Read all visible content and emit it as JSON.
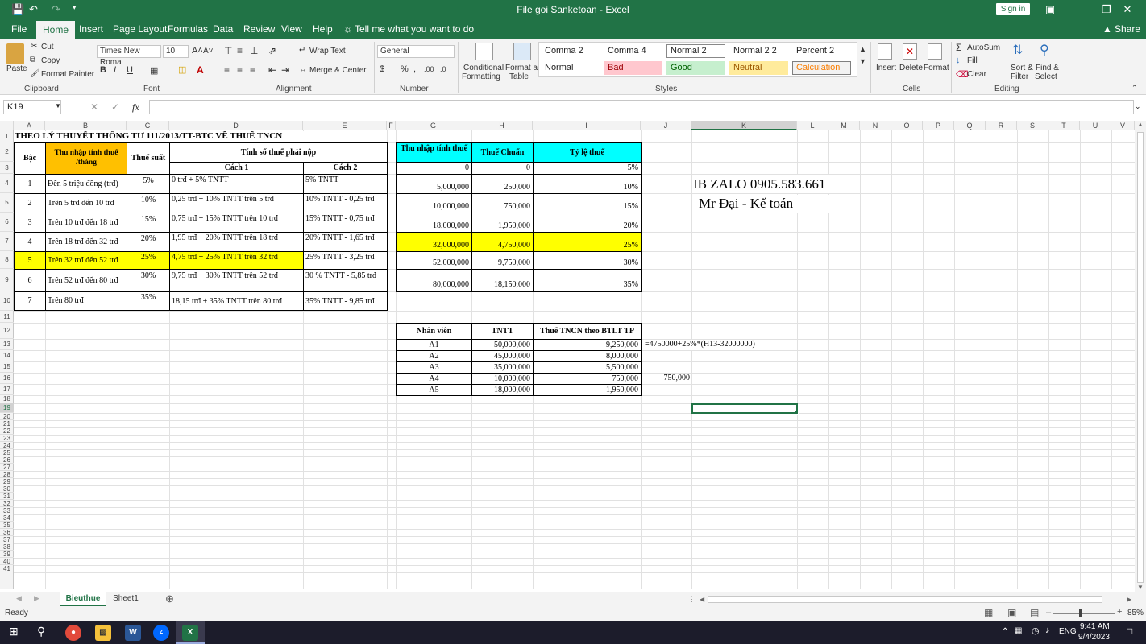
{
  "window": {
    "title": "File goi Sanketoan  -  Excel",
    "sign_in": "Sign in"
  },
  "ribbon_tabs": [
    "File",
    "Home",
    "Insert",
    "Page Layout",
    "Formulas",
    "Data",
    "Review",
    "View",
    "Help"
  ],
  "tell_me": "Tell me what you want to do",
  "share": "Share",
  "clipboard": {
    "paste": "Paste",
    "cut": "Cut",
    "copy": "Copy",
    "format_painter": "Format Painter",
    "group": "Clipboard"
  },
  "font": {
    "name": "Times New Roma",
    "size": "10",
    "group": "Font"
  },
  "alignment": {
    "wrap": "Wrap Text",
    "merge": "Merge & Center",
    "group": "Alignment"
  },
  "number": {
    "format": "General",
    "group": "Number"
  },
  "styles": {
    "conditional": "Conditional",
    "formatting": "Formatting",
    "format_as": "Format as",
    "table": "Table",
    "group": "Styles",
    "cells": [
      "Comma 2",
      "Comma 4",
      "Normal 2",
      "Normal 2 2",
      "Percent 2",
      "Normal",
      "Bad",
      "Good",
      "Neutral",
      "Calculation"
    ]
  },
  "cells_group": {
    "insert": "Insert",
    "delete": "Delete",
    "format": "Format",
    "group": "Cells"
  },
  "editing": {
    "autosum": "AutoSum",
    "fill": "Fill",
    "clear": "Clear",
    "sort": "Sort &",
    "filter": "Filter",
    "find": "Find &",
    "select": "Select",
    "group": "Editing"
  },
  "formula_bar": {
    "name_box": "K19",
    "fx": "fx",
    "formula": ""
  },
  "columns": [
    "A",
    "B",
    "C",
    "D",
    "E",
    "F",
    "G",
    "H",
    "I",
    "J",
    "K",
    "L",
    "M",
    "N",
    "O",
    "P",
    "Q",
    "R",
    "S",
    "T",
    "U",
    "V"
  ],
  "rows": [
    "1",
    "2",
    "3",
    "4",
    "5",
    "6",
    "7",
    "8",
    "9",
    "10",
    "11",
    "12",
    "13",
    "14",
    "15",
    "16",
    "17",
    "18",
    "19",
    "20",
    "21",
    "22",
    "23",
    "24",
    "25",
    "26",
    "27",
    "28",
    "29",
    "30",
    "31",
    "32",
    "33",
    "34",
    "35",
    "36",
    "37",
    "38",
    "39",
    "40",
    "41"
  ],
  "sheet": {
    "title": "THEO LÝ THUYẾT THÔNG TƯ 111/2013/TT-BTC VỀ THUẾ TNCN",
    "h_bac": "Bậc",
    "h_thunhap": "Thu nhập tính thuế /tháng",
    "h_thuesuat": "Thuế suất",
    "h_tinhso": "Tính số thuế phải nộp",
    "h_cach1": "Cách 1",
    "h_cach2": "Cách 2",
    "rows": [
      {
        "bac": "1",
        "thunhap": "Đến 5 triệu đồng (trđ)",
        "suat": "5%",
        "c1": "0 trđ + 5% TNTT",
        "c2": "5% TNTT"
      },
      {
        "bac": "2",
        "thunhap": "Trên 5 trđ đến 10 trđ",
        "suat": "10%",
        "c1": "0,25 trđ + 10% TNTT trên 5 trđ",
        "c2": "10% TNTT - 0,25 trđ"
      },
      {
        "bac": "3",
        "thunhap": "Trên 10 trđ đến 18 trđ",
        "suat": "15%",
        "c1": "0,75 trđ + 15% TNTT trên 10 trđ",
        "c2": "15% TNTT - 0,75 trđ"
      },
      {
        "bac": "4",
        "thunhap": "Trên 18 trđ đến 32 trđ",
        "suat": "20%",
        "c1": "1,95 trđ + 20% TNTT trên 18 trđ",
        "c2": "20% TNTT - 1,65 trđ"
      },
      {
        "bac": "5",
        "thunhap": "Trên 32 trđ đến 52 trđ",
        "suat": "25%",
        "c1": "4,75 trđ + 25% TNTT trên 32 trđ",
        "c2": "25% TNTT - 3,25 trđ"
      },
      {
        "bac": "6",
        "thunhap": "Trên 52 trđ đến 80 trđ",
        "suat": "30%",
        "c1": "9,75 trđ + 30% TNTT trên 52 trđ",
        "c2": "30 % TNTT - 5,85 trđ"
      },
      {
        "bac": "7",
        "thunhap": "Trên 80 trđ",
        "suat": "35%",
        "c1": "18,15 trđ + 35% TNTT trên 80 trđ",
        "c2": "35% TNTT - 9,85 trđ"
      }
    ],
    "g_head": "Thu nhập tính thuế",
    "h_head": "Thuế Chuẩn",
    "i_head": "Tỷ lệ thuế",
    "ghi": [
      [
        "0",
        "0",
        "5%"
      ],
      [
        "5,000,000",
        "250,000",
        "10%"
      ],
      [
        "10,000,000",
        "750,000",
        "15%"
      ],
      [
        "18,000,000",
        "1,950,000",
        "20%"
      ],
      [
        "32,000,000",
        "4,750,000",
        "25%"
      ],
      [
        "52,000,000",
        "9,750,000",
        "30%"
      ],
      [
        "80,000,000",
        "18,150,000",
        "35%"
      ]
    ],
    "zalo": "IB ZALO 0905.583.661",
    "mrdai": "Mr Đại - Kế toán",
    "nv_head": "Nhân viên",
    "tntt_head": "TNTT",
    "tncn_head": "Thuế TNCN theo BTLT TP",
    "nv": [
      [
        "A1",
        "50,000,000",
        "9,250,000"
      ],
      [
        "A2",
        "45,000,000",
        "8,000,000"
      ],
      [
        "A3",
        "35,000,000",
        "5,500,000"
      ],
      [
        "A4",
        "10,000,000",
        "750,000"
      ],
      [
        "A5",
        "18,000,000",
        "1,950,000"
      ]
    ],
    "formula_text": "=4750000+25%*(H13-32000000)",
    "j16": "750,000"
  },
  "sheet_tabs": [
    "Bieuthue",
    "Sheet1"
  ],
  "status": {
    "ready": "Ready",
    "zoom": "85%"
  },
  "taskbar": {
    "lang": "ENG",
    "time": "9:41 AM",
    "date": "9/4/2023"
  },
  "colors": {
    "excel_green": "#217346",
    "header_orange": "#ffc000",
    "header_cyan": "#00ffff",
    "highlight_yellow": "#ffff00"
  }
}
